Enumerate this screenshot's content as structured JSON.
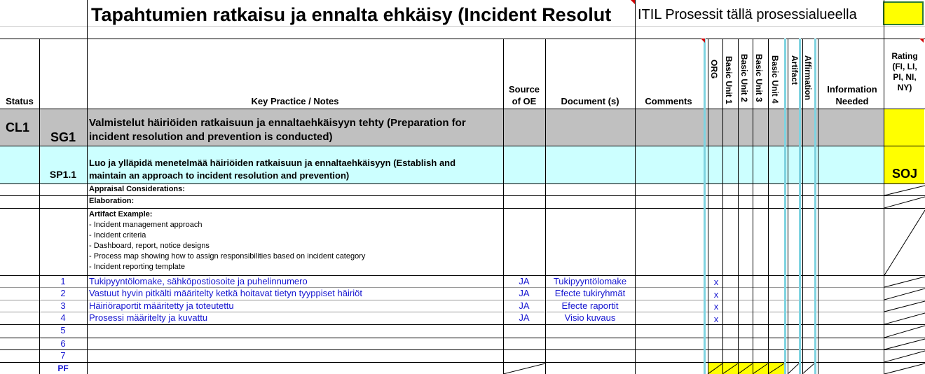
{
  "title": "Tapahtumien ratkaisu ja ennalta ehkäisy (Incident Resolut",
  "itil_label": "ITIL Prosessit tällä prosessialueella",
  "headers": {
    "status": "Status",
    "key_practice": "Key Practice / Notes",
    "source_line1": "Source",
    "source_line2": "of OE",
    "document": "Document (s)",
    "comments": "Comments",
    "org": "ORG",
    "unit1": "Basic Unit 1",
    "unit2": "Basic Unit 2",
    "unit3": "Basic Unit 3",
    "unit4": "Basic Unit 4",
    "artifact": "Artifact",
    "affirmation": "Affirmation",
    "info_line1": "Information",
    "info_line2": "Needed",
    "rating_l1": "Rating",
    "rating_l2": "(FI, LI,",
    "rating_l3": "PI, NI,",
    "rating_l4": "NY)"
  },
  "cl1_row": {
    "status": "CL1",
    "id": "SG1",
    "line1": "Valmistelut häiriöiden ratkaisuun ja ennaltaehkäisyyn tehty (Preparation for",
    "line2": "incident resolution and prevention is conducted)"
  },
  "sp_row": {
    "id": "SP1.1",
    "line1": "Luo ja ylläpidä menetelmää häiriöiden ratkaisuun ja ennaltaehkäisyyn (Establish and",
    "line2": "maintain an approach to incident resolution and prevention)",
    "rating": "SOJ"
  },
  "appraisal": "Appraisal Considerations:",
  "elaboration": "Elaboration:",
  "artifact_example": {
    "heading": "Artifact Example:",
    "items": [
      "- Incident management approach",
      "- Incident criteria",
      "-  Dashboard, report, notice designs",
      "-  Process map showing how to assign responsibilities based on incident category",
      "-  Incident reporting template"
    ]
  },
  "rows": [
    {
      "num": "1",
      "text": "Tukipyyntölomake, sähköpostiosoite ja puhelinnumero",
      "source": "JA",
      "doc": "Tukipyyntölomake",
      "org": "x"
    },
    {
      "num": "2",
      "text": "Vastuut hyvin pitkälti määritelty ketkä hoitavat tietyn tyyppiset häiriöt",
      "source": "JA",
      "doc": "Efecte tukiryhmät",
      "org": "x"
    },
    {
      "num": "3",
      "text": "Häiriöraportit määritetty ja toteutettu",
      "source": "JA",
      "doc": "Efecte raportit",
      "org": "x"
    },
    {
      "num": "4",
      "text": "Prosessi määritelty ja kuvattu",
      "source": "JA",
      "doc": "Visio kuvaus",
      "org": "x"
    },
    {
      "num": "5",
      "text": "",
      "source": "",
      "doc": "",
      "org": ""
    },
    {
      "num": "6",
      "text": "",
      "source": "",
      "doc": "",
      "org": ""
    },
    {
      "num": "7",
      "text": "",
      "source": "",
      "doc": "",
      "org": ""
    }
  ],
  "pf_label": "PF",
  "colors": {
    "yellow": "#ffff00",
    "gray": "#c0c0c0",
    "cyan": "#ccffff",
    "link_blue": "#1515d0"
  }
}
